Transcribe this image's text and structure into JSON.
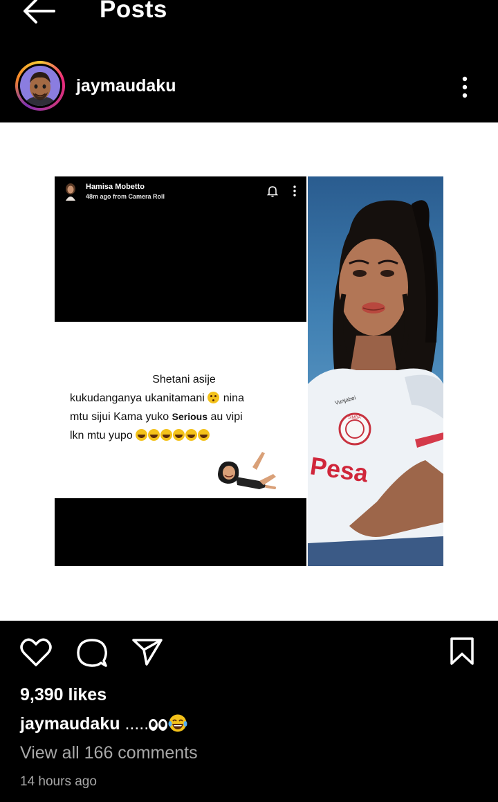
{
  "header": {
    "title": "Posts",
    "back_icon": "arrow-left-icon"
  },
  "post": {
    "username": "jaymaudaku",
    "avatar_icon": "memoji-avatar",
    "more_icon": "more-vertical-icon",
    "media": {
      "story": {
        "name": "Hamisa Mobetto",
        "meta": "48m ago from Camera Roll",
        "text_line1": "Shetani asije",
        "text_line2": "kukudanganya ukanitamani",
        "text_line2_end": "nina",
        "text_line3_start": "mtu sijui Kama yuko",
        "text_line3_serious": "Serious",
        "text_line3_end": "au vipi",
        "text_line4": "lkn mtu yupo",
        "laugh_count": 6
      },
      "jersey_text": "Pesa",
      "jersey_brand": "Vunjabei",
      "jersey_badge": "SIMBA"
    },
    "actions": {
      "like_icon": "heart-icon",
      "comment_icon": "comment-icon",
      "share_icon": "send-icon",
      "save_icon": "bookmark-icon"
    },
    "likes": "9,390 likes",
    "caption": {
      "username": "jaymaudaku",
      "text": " .....",
      "emoji_icons": [
        "eyes-emoji",
        "laughing-tears-emoji"
      ]
    },
    "view_comments": "View all 166 comments",
    "timestamp": "14 hours ago"
  },
  "colors": {
    "background": "#000000",
    "text": "#ffffff",
    "secondary_text": "#a8a8a8",
    "story_ring": [
      "#f9ce34",
      "#ee2a7b",
      "#8134af"
    ],
    "emoji_yellow": "#f4c21a"
  }
}
